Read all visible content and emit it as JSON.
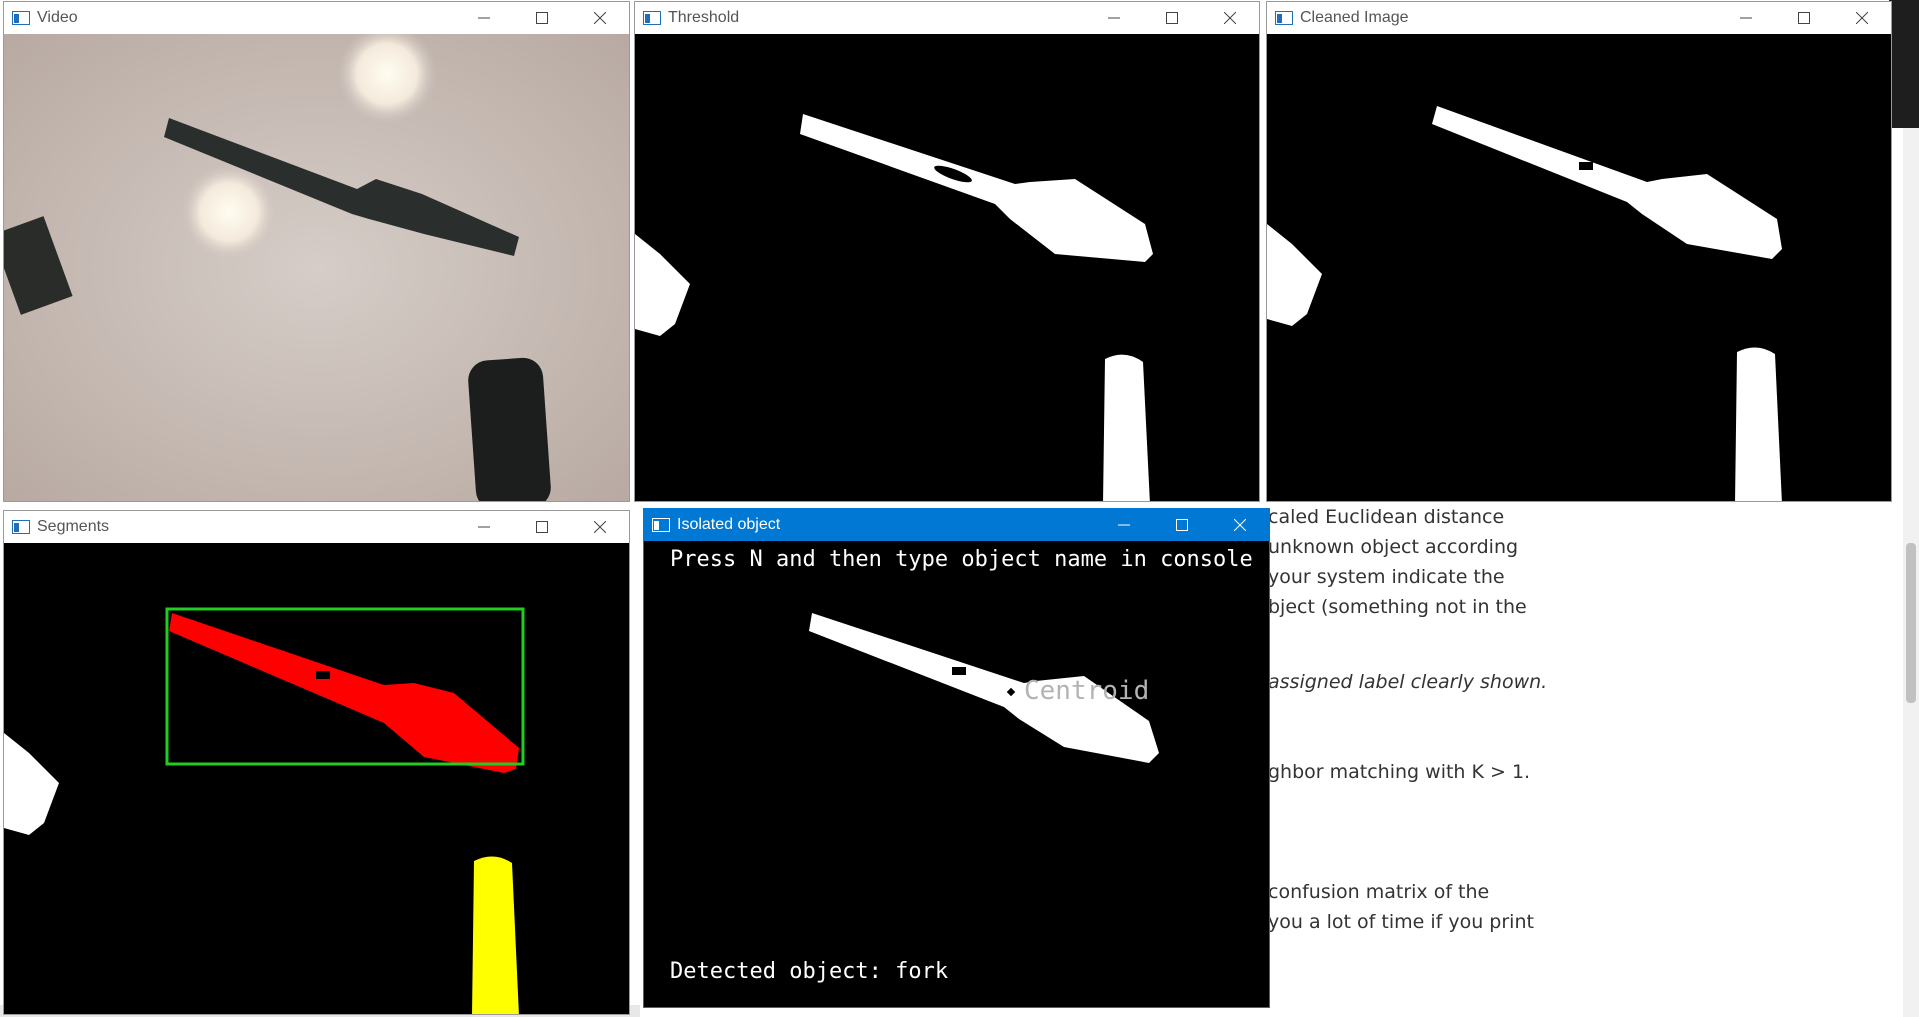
{
  "background_document": {
    "lines": [
      {
        "text": "caled Euclidean distance",
        "italic": false
      },
      {
        "text": "unknown object according",
        "italic": false
      },
      {
        "text": "your system indicate the",
        "italic": false
      },
      {
        "text": "bject (something not in the",
        "italic": false
      },
      {
        "text": "assigned label clearly shown.",
        "italic": true
      },
      {
        "text": "ghbor matching with K > 1.",
        "italic": false
      },
      {
        "text": "confusion matrix of the",
        "italic": false
      },
      {
        "text": "you a lot of time if you print",
        "italic": false
      }
    ]
  },
  "windows": {
    "video": {
      "title": "Video"
    },
    "threshold": {
      "title": "Threshold"
    },
    "cleaned": {
      "title": "Cleaned Image"
    },
    "segments": {
      "title": "Segments"
    },
    "isolated": {
      "title": "Isolated object",
      "instruction": "Press N and then type object name in console",
      "centroid_label": "Centroid",
      "detected": "Detected object: fork"
    }
  },
  "colors": {
    "accent": "#0078d4",
    "region_fork": "#ff0000",
    "region_marker": "#ffff00",
    "bounding_box": "#22cc22"
  },
  "icons": {
    "minimize": "minimize-icon",
    "maximize": "maximize-icon",
    "close": "close-icon",
    "app": "app-window-icon"
  }
}
